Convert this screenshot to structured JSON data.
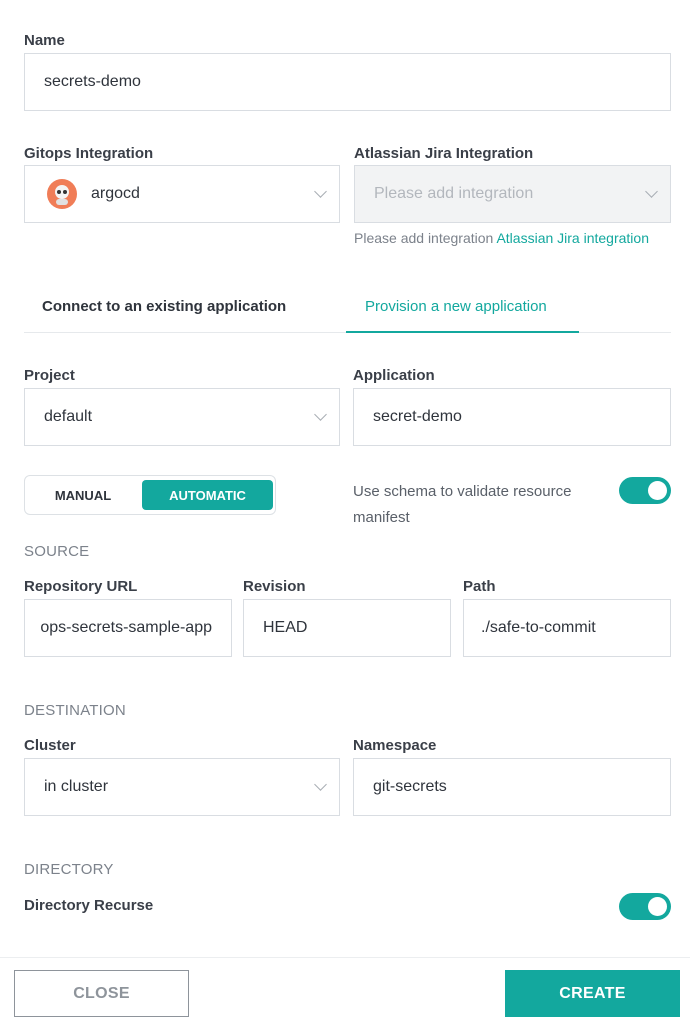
{
  "name": {
    "label": "Name",
    "value": "secrets-demo"
  },
  "gitops": {
    "label": "Gitops Integration",
    "value": "argocd",
    "icon": "argocd-logo-icon"
  },
  "jira": {
    "label": "Atlassian Jira Integration",
    "placeholder": "Please add integration",
    "hint": "Please add integration",
    "hint_link": "Atlassian Jira integration"
  },
  "tabs": [
    {
      "label": "Connect to an existing application",
      "active": false
    },
    {
      "label": "Provision a new application",
      "active": true
    }
  ],
  "project": {
    "label": "Project",
    "value": "default"
  },
  "application": {
    "label": "Application",
    "value": "secret-demo"
  },
  "sync_mode": {
    "options": [
      "MANUAL",
      "AUTOMATIC"
    ],
    "selected": "AUTOMATIC"
  },
  "schema_toggle": {
    "label": "Use schema to validate resource manifest",
    "on": true
  },
  "source": {
    "title": "SOURCE",
    "repo": {
      "label": "Repository URL",
      "value": "ops-secrets-sample-app"
    },
    "revision": {
      "label": "Revision",
      "value": "HEAD"
    },
    "path": {
      "label": "Path",
      "value": "./safe-to-commit"
    }
  },
  "destination": {
    "title": "DESTINATION",
    "cluster": {
      "label": "Cluster",
      "value": "in cluster"
    },
    "namespace": {
      "label": "Namespace",
      "value": "git-secrets"
    }
  },
  "directory": {
    "title": "DIRECTORY",
    "recurse": {
      "label": "Directory Recurse",
      "on": true
    }
  },
  "footer": {
    "close": "CLOSE",
    "create": "CREATE"
  },
  "colors": {
    "accent": "#13a89e",
    "border": "#d9dde2"
  }
}
